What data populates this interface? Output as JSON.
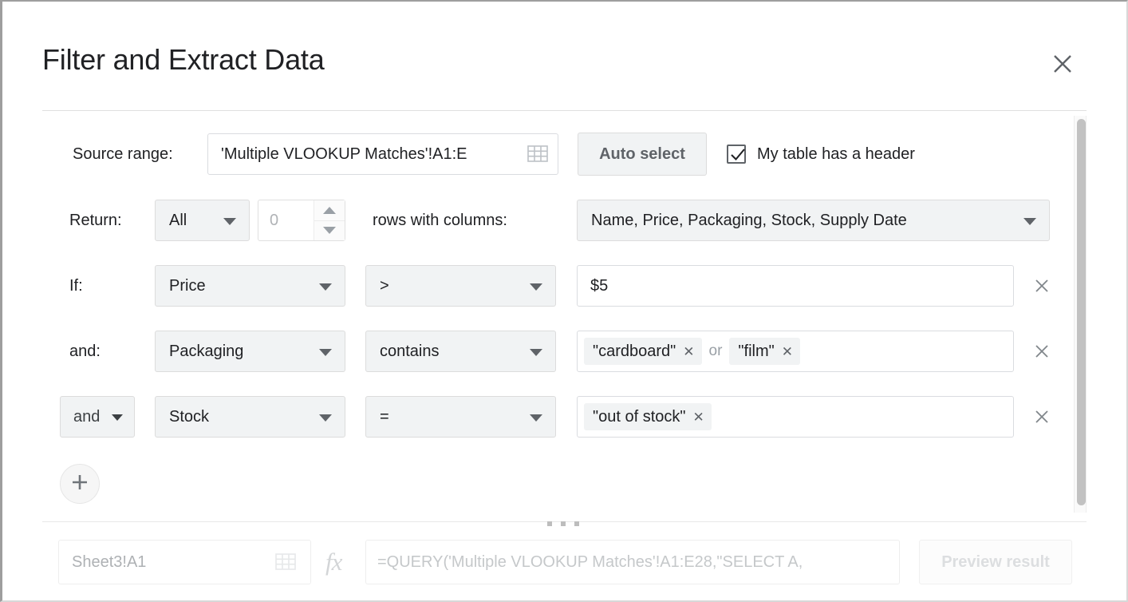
{
  "dialog": {
    "title": "Filter and Extract Data",
    "close_icon": "close-icon"
  },
  "source": {
    "label": "Source range:",
    "value": "'Multiple VLOOKUP Matches'!A1:E",
    "picker_icon": "grid-picker-icon",
    "auto_select_label": "Auto select",
    "header_checkbox_label": "My table has a header",
    "header_checkbox_checked": true
  },
  "return": {
    "label": "Return:",
    "mode": "All",
    "count": "0",
    "middle_label": "rows with columns:",
    "columns": "Name, Price, Packaging, Stock, Supply Date"
  },
  "conditions": [
    {
      "label": "If:",
      "label_type": "text",
      "field": "Price",
      "operator": ">",
      "value_text": "$5",
      "chips": [],
      "remove_icon": "remove-condition-icon"
    },
    {
      "label": "and:",
      "label_type": "text",
      "field": "Packaging",
      "operator": "contains",
      "value_text": "",
      "chips": [
        "\"cardboard\"",
        "\"film\""
      ],
      "chip_joiner": "or",
      "remove_icon": "remove-condition-icon"
    },
    {
      "label": "and",
      "label_type": "dropdown",
      "field": "Stock",
      "operator": "=",
      "value_text": "",
      "chips": [
        "\"out of stock\""
      ],
      "chip_joiner": "",
      "remove_icon": "remove-condition-icon"
    }
  ],
  "add_condition": {
    "icon": "plus-icon"
  },
  "footer": {
    "destination_placeholder": "Sheet3!A1",
    "destination_picker_icon": "grid-picker-icon",
    "fx_icon": "fx-icon",
    "formula": "=QUERY('Multiple VLOOKUP Matches'!A1:E28,\"SELECT A,",
    "preview_label": "Preview result"
  },
  "colors": {
    "text": "#202124",
    "control_bg": "#f1f3f4",
    "border": "#dcdcdc",
    "muted": "#9aa0a6",
    "disabled": "#dcdee0"
  }
}
